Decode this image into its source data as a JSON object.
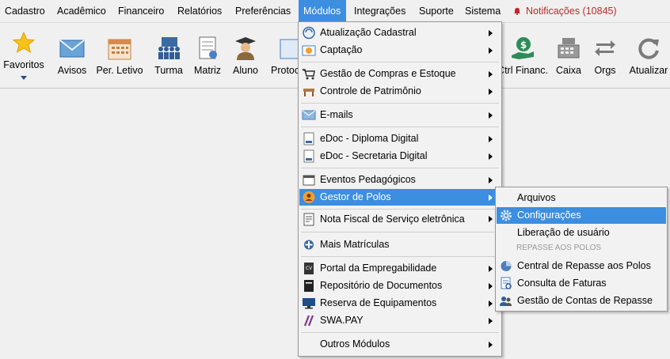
{
  "menubar": {
    "items": [
      "Cadastro",
      "Acadêmico",
      "Financeiro",
      "Relatórios",
      "Preferências",
      "Módulos",
      "Integrações",
      "Suporte",
      "Sistema"
    ],
    "notifications": "Notificações (10845)"
  },
  "toolbar": {
    "favoritos": "Favoritos",
    "avisos": "Avisos",
    "per_letivo": "Per. Letivo",
    "turma": "Turma",
    "matriz": "Matriz",
    "aluno": "Aluno",
    "protocolo": "Protoc",
    "ctrl_financ": "Ctrl Financ.",
    "caixa": "Caixa",
    "orgs": "Orgs",
    "atualizar": "Atualizar"
  },
  "modulos_menu": {
    "items": [
      "Atualização Cadastral",
      "Captação",
      "Gestão de Compras e Estoque",
      "Controle de Patrimônio",
      "E-mails",
      "eDoc - Diploma Digital",
      "eDoc - Secretaria Digital",
      "Eventos Pedagógicos",
      "Gestor de Polos",
      "Nota Fiscal de Serviço eletrônica",
      "Mais Matrículas",
      "Portal da Empregabilidade",
      "Repositório de Documentos",
      "Reserva de Equipamentos",
      "SWA.PAY",
      "Outros Módulos"
    ]
  },
  "polos_submenu": {
    "arquivos": "Arquivos",
    "configuracoes": "Configurações",
    "liberacao": "Liberação de usuário",
    "header_repasse": "REPASSE AOS POLOS",
    "central_repasse": "Central de Repasse aos Polos",
    "consulta_faturas": "Consulta de Faturas",
    "gestao_contas": "Gestão de Contas de Repasse"
  },
  "colors": {
    "highlight": "#3c8ee0",
    "notification": "#c0282d"
  }
}
